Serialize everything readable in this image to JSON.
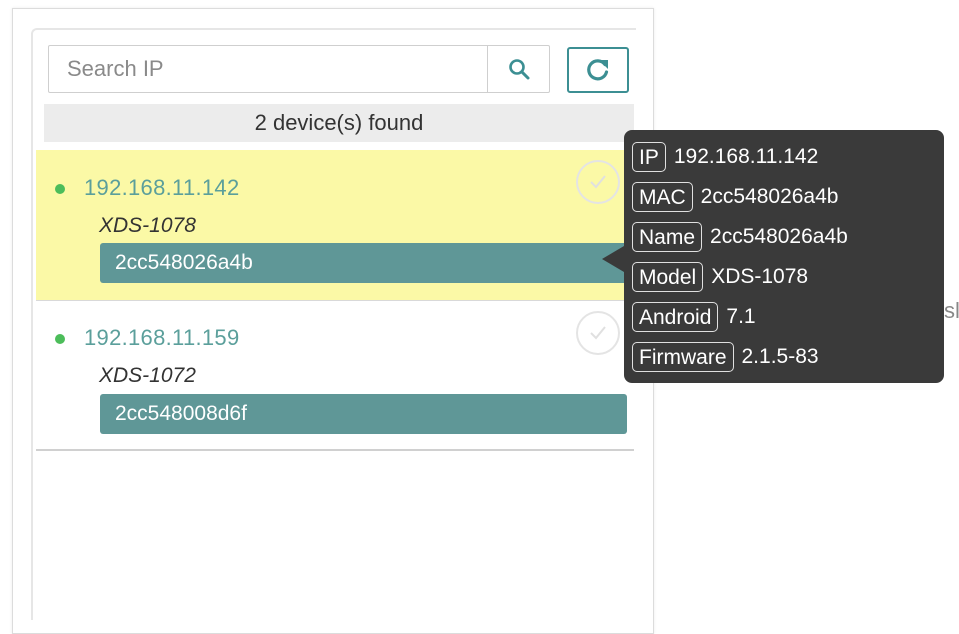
{
  "search": {
    "placeholder": "Search IP"
  },
  "icons": {
    "search": "search-icon",
    "refresh": "refresh-icon",
    "check": "check-circle-icon",
    "status": "online-dot-icon"
  },
  "colors": {
    "accent": "#3c8f93",
    "selected_bg": "#fbf9a6",
    "name_bar": "#5f9797",
    "online": "#4cbd5a",
    "tooltip_bg": "#3a3a3a"
  },
  "status_text": "2 device(s) found",
  "devices": [
    {
      "ip": "192.168.11.142",
      "model": "XDS-1078",
      "name": "2cc548026a4b",
      "selected": true
    },
    {
      "ip": "192.168.11.159",
      "model": "XDS-1072",
      "name": "2cc548008d6f",
      "selected": false
    }
  ],
  "tooltip": {
    "rows": [
      {
        "key": "IP",
        "value": "192.168.11.142"
      },
      {
        "key": "MAC",
        "value": "2cc548026a4b"
      },
      {
        "key": "Name",
        "value": "2cc548026a4b"
      },
      {
        "key": "Model",
        "value": "XDS-1078"
      },
      {
        "key": "Android",
        "value": "7.1"
      },
      {
        "key": "Firmware",
        "value": "2.1.5-83"
      }
    ]
  },
  "edge_text": "sl"
}
